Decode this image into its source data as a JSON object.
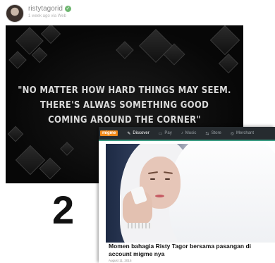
{
  "post": {
    "username": "ristytagorid",
    "meta": "1 week ago via Web",
    "verified_color": "#6db66f"
  },
  "quote": {
    "lines": [
      "\"NO MATTER HOW HARD THINGS MAY SEEM.",
      "THERE'S ALWAS SOMETHING GOOD",
      "COMING AROUND THE CORNER\""
    ]
  },
  "overlay_number": "2",
  "app": {
    "logo": "migme",
    "nav": [
      {
        "label": "Discover",
        "icon": "✎",
        "active": true
      },
      {
        "label": "Pay",
        "icon": "▭",
        "active": false
      },
      {
        "label": "Music",
        "icon": "♪",
        "active": false
      },
      {
        "label": "Store",
        "icon": "⇆",
        "active": false
      },
      {
        "label": "Merchant",
        "icon": "◎",
        "active": false
      }
    ],
    "accent_color": "#3c9c84",
    "article": {
      "headline": "Momen bahagia Risty Tagor bersama pasangan di account migme nya",
      "date": "August 11, 2015"
    }
  }
}
